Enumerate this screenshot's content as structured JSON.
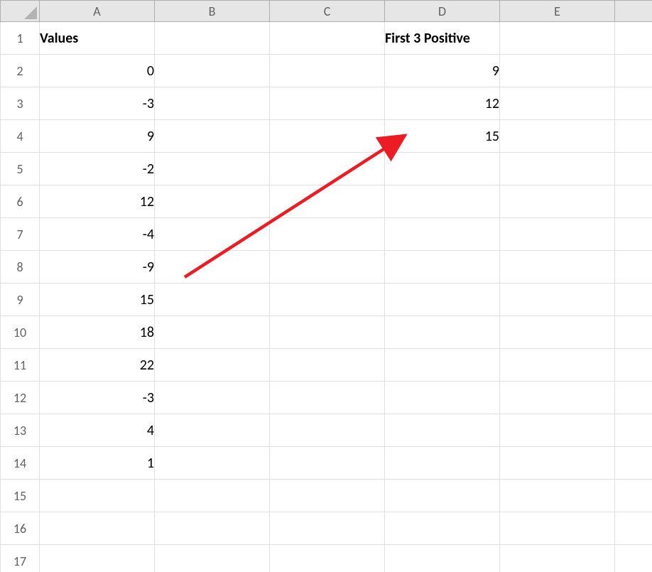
{
  "columns": [
    "A",
    "B",
    "C",
    "D",
    "E"
  ],
  "rows": [
    "1",
    "2",
    "3",
    "4",
    "5",
    "6",
    "7",
    "8",
    "9",
    "10",
    "11",
    "12",
    "13",
    "14",
    "15",
    "16",
    "17"
  ],
  "cells": {
    "A1": {
      "value": "Values",
      "bold": true,
      "align": "left"
    },
    "A2": {
      "value": "0",
      "align": "right"
    },
    "A3": {
      "value": "-3",
      "align": "right"
    },
    "A4": {
      "value": "9",
      "align": "right"
    },
    "A5": {
      "value": "-2",
      "align": "right"
    },
    "A6": {
      "value": "12",
      "align": "right"
    },
    "A7": {
      "value": "-4",
      "align": "right"
    },
    "A8": {
      "value": "-9",
      "align": "right"
    },
    "A9": {
      "value": "15",
      "align": "right"
    },
    "A10": {
      "value": "18",
      "align": "right"
    },
    "A11": {
      "value": "22",
      "align": "right"
    },
    "A12": {
      "value": "-3",
      "align": "right"
    },
    "A13": {
      "value": "4",
      "align": "right"
    },
    "A14": {
      "value": "1",
      "align": "right"
    },
    "D1": {
      "value": "First 3 Positive",
      "bold": true,
      "align": "left"
    },
    "D2": {
      "value": "9",
      "align": "right"
    },
    "D3": {
      "value": "12",
      "align": "right"
    },
    "D4": {
      "value": "15",
      "align": "right"
    }
  },
  "annotation": {
    "type": "arrow",
    "color": "#ed1c24",
    "from_cell": "B8",
    "to_cell": "D3"
  }
}
